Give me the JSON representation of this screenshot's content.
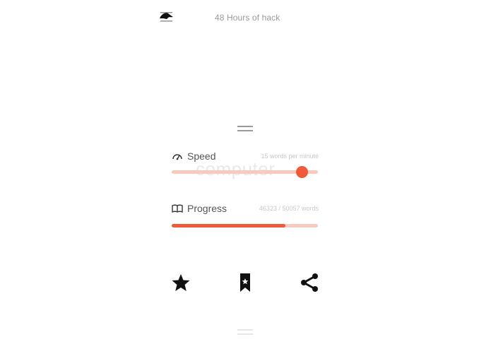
{
  "header": {
    "title": "48 Hours of hack",
    "menu_icon": "hamburger-menu-icon"
  },
  "speed": {
    "label": "Speed",
    "icon": "speedometer-icon",
    "meta": "15 words per minute",
    "current_word": "computer",
    "slider_fraction": 0.89
  },
  "progress": {
    "label": "Progress",
    "icon": "book-icon",
    "meta": "46323 / 50057 words",
    "fraction": 0.78
  },
  "actions": [
    {
      "name": "favorite",
      "icon": "star-icon"
    },
    {
      "name": "bookmark",
      "icon": "bookmark-star-icon"
    },
    {
      "name": "share",
      "icon": "share-icon"
    }
  ],
  "colors": {
    "accent": "#ee5a3a",
    "accent_light": "#f8c9bd",
    "text": "#555555",
    "muted": "#9a9a9a"
  }
}
